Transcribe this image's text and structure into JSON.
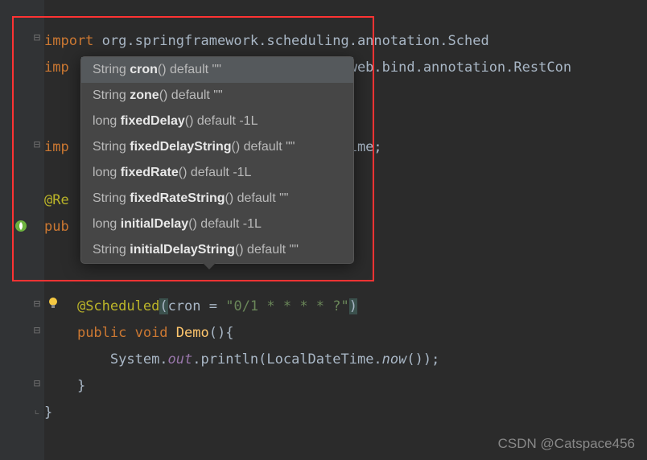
{
  "code": {
    "line1_kw": "import",
    "line1_pkg": " org.springframework.scheduling.annotation.",
    "line1_cls": "Sched",
    "line2_kw": "imp",
    "line2_pkg": "                                  web.bind.annotation.",
    "line2_cls": "RestCon",
    "line4_kw": "imp",
    "line4_pkg": "                                  ime",
    "line4_semi": ";",
    "line6_ann": "@Re",
    "line7_kw": "pub",
    "line9_ann": "@Scheduled",
    "line9_paren_open": "(",
    "line9_param": "cron = ",
    "line9_str": "\"0/1 * * * * ?\"",
    "line9_paren_close": ")",
    "line10_kw": "public void ",
    "line10_method": "Demo",
    "line10_rest": "(){",
    "line11_cls": "System.",
    "line11_field": "out",
    "line11_dot": ".println(LocalDateTime.",
    "line11_method": "now",
    "line11_rest": "());",
    "line12": "}",
    "line13": "}"
  },
  "popup": {
    "items": [
      {
        "type": "String",
        "name": "cron",
        "suffix": "() default \"\""
      },
      {
        "type": "String",
        "name": "zone",
        "suffix": "() default \"\""
      },
      {
        "type": "long",
        "name": "fixedDelay",
        "suffix": "() default -1L"
      },
      {
        "type": "String",
        "name": "fixedDelayString",
        "suffix": "() default \"\""
      },
      {
        "type": "long",
        "name": "fixedRate",
        "suffix": "() default -1L"
      },
      {
        "type": "String",
        "name": "fixedRateString",
        "suffix": "() default \"\""
      },
      {
        "type": "long",
        "name": "initialDelay",
        "suffix": "() default -1L"
      },
      {
        "type": "String",
        "name": "initialDelayString",
        "suffix": "() default \"\""
      }
    ]
  },
  "watermark": "CSDN @Catspace456"
}
